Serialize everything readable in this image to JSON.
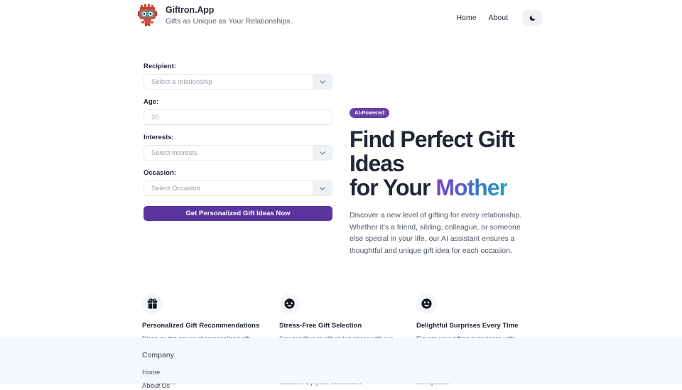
{
  "header": {
    "brand_name": "Giftron.App",
    "tagline": "Gifts as Unique as Your Relationships.",
    "logo_icon": "robot-mascot-icon",
    "nav": [
      {
        "label": "Home",
        "name": "nav-link-home"
      },
      {
        "label": "About",
        "name": "nav-link-about"
      }
    ],
    "theme_toggle_icon": "moon-icon"
  },
  "form": {
    "recipient": {
      "label": "Recipient:",
      "placeholder": "Select a relationship"
    },
    "age": {
      "label": "Age:",
      "placeholder": "20",
      "value": ""
    },
    "interests": {
      "label": "Interests:",
      "placeholder": "Select interests"
    },
    "occasion": {
      "label": "Occasion:",
      "placeholder": "Select Occasion"
    },
    "submit_label": "Get Personalized Gift Ideas Now",
    "submit_color": "#5b359e"
  },
  "hero": {
    "badge": "AI-Powered",
    "badge_color": "#6b3fa8",
    "headline_line1": "Find Perfect Gift Ideas",
    "headline_line2_prefix": "for Your ",
    "headline_accent": "Mother",
    "accent_gradient_from": "#7b43c2",
    "accent_gradient_to": "#20a5bd",
    "description": "Discover a new level of gifting for every relationship. Whether it's a friend, sibling, colleague, or someone else special in your life, our AI assistant ensures a thoughtful and unique gift idea for each occasion."
  },
  "features": [
    {
      "icon": "gift-box-icon",
      "title": "Personalized Gift Recommendations",
      "body": "Discover the power of personalized gift suggestions tailored to your loved ones' unique tastes and interests. Our AI-driven app ensures every gift idea is a thoughtful match, making your moments of giving truly special."
    },
    {
      "icon": "star-struck-face-icon",
      "title": "Stress-Free Gift Selection",
      "body": "Say goodbye to gift-giving stress with our intuitive app. Effortlessly navigate through a curated selection of unique and meaningful gift ideas. The perfect present is just a click away, making every occasion a joyous celebration."
    },
    {
      "icon": "grinning-face-icon",
      "title": "Delightful Surprises Every Time",
      "body": "Elevate your gifting experience with delightful surprises. Our AI-enhanced tool ensures a constant stream of fresh and imaginative gift ideas, ensuring you never run out of ways to make your loved ones feel special."
    }
  ],
  "footer": {
    "heading": "Company",
    "links": [
      {
        "label": "Home"
      },
      {
        "label": "About Us"
      }
    ]
  }
}
